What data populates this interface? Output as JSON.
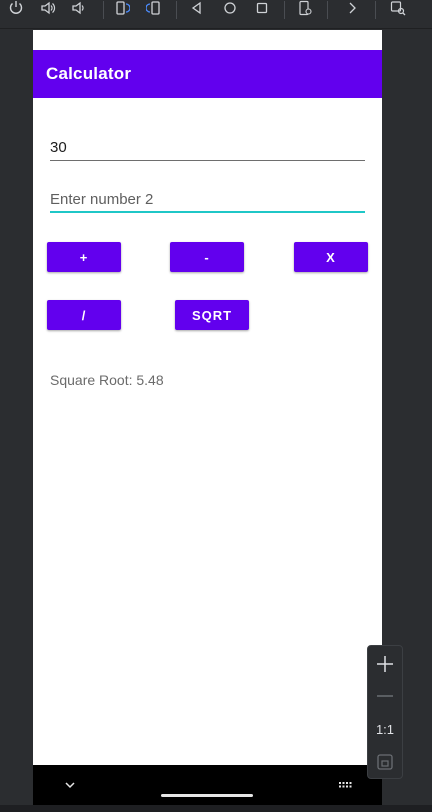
{
  "app": {
    "title": "Calculator"
  },
  "inputs": {
    "number1_value": "30",
    "number2_placeholder": "Enter number 2"
  },
  "buttons": {
    "add": "+",
    "subtract": "-",
    "multiply": "X",
    "divide": "/",
    "sqrt": "SQRT"
  },
  "result": {
    "text": "Square Root: 5.48"
  },
  "emulator": {
    "zoom_ratio": "1:1",
    "toolbar_icons": [
      "power-icon",
      "volume-up-icon",
      "volume-down-icon",
      "rotate-left-icon",
      "rotate-right-icon",
      "back-icon",
      "home-icon",
      "overview-icon",
      "device-settings-icon",
      "more-icon",
      "screenshot-search-icon"
    ]
  },
  "colors": {
    "primary": "#6200ee",
    "focus_underline": "#1fc7c7",
    "editor_bg": "#2b2d30"
  }
}
